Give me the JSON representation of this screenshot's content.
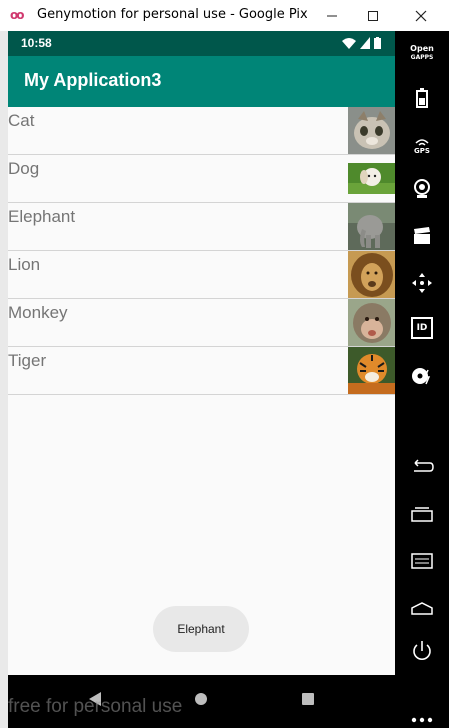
{
  "window": {
    "title": "Genymotion for personal use - Google Pixel...",
    "controls": [
      "minimize",
      "maximize",
      "close"
    ]
  },
  "status_bar": {
    "time": "10:58"
  },
  "app_bar": {
    "title": "My Application3"
  },
  "list": [
    {
      "label": "Cat",
      "image": "cat-photo"
    },
    {
      "label": "Dog",
      "image": "dog-photo"
    },
    {
      "label": "Elephant",
      "image": "elephant-photo"
    },
    {
      "label": "Lion",
      "image": "lion-photo"
    },
    {
      "label": "Monkey",
      "image": "monkey-photo"
    },
    {
      "label": "Tiger",
      "image": "tiger-photo"
    }
  ],
  "toast": {
    "text": "Elephant"
  },
  "watermark": "free for personal use",
  "toolbar": {
    "opengapps_line1": "Open",
    "opengapps_line2": "GAPPS",
    "gps_label": "GPS",
    "id_label": "ID",
    "items": [
      "opengapps",
      "battery",
      "gps",
      "camera",
      "capture",
      "dpad",
      "identifiers",
      "disk-io",
      "back",
      "recent-apps",
      "menu",
      "home",
      "power",
      "more"
    ]
  },
  "colors": {
    "status_bar": "#00574b",
    "app_bar": "#008577",
    "list_bg": "#fafafa"
  }
}
